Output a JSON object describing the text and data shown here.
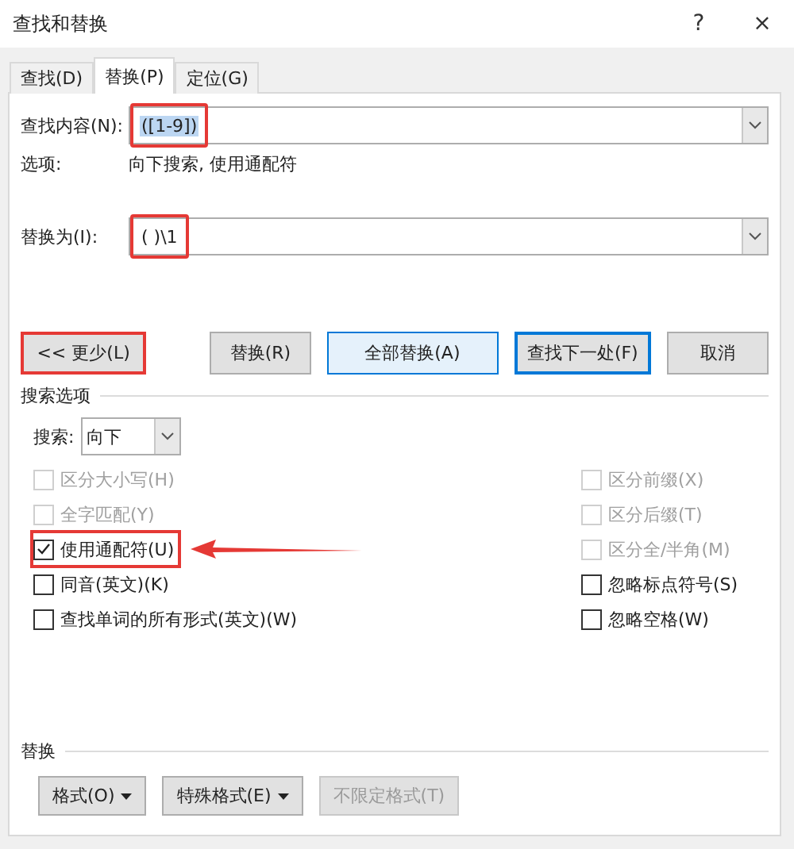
{
  "window": {
    "title": "查找和替换",
    "help": "?",
    "close": "×"
  },
  "tabs": [
    {
      "label": "查找(D)",
      "selected": false
    },
    {
      "label": "替换(P)",
      "selected": true
    },
    {
      "label": "定位(G)",
      "selected": false
    }
  ],
  "find": {
    "label": "查找内容(N):",
    "value": "([1-9])",
    "value_selected": true,
    "annotated": true
  },
  "options": {
    "label": "选项:",
    "value": "向下搜索, 使用通配符"
  },
  "replace": {
    "label": "替换为(I):",
    "value": "( )\\1",
    "annotated": true
  },
  "buttons": [
    {
      "label": "<< 更少(L)",
      "kind": "normal",
      "annotated": true
    },
    {
      "label": "替换(R)",
      "kind": "normal",
      "annotated": false
    },
    {
      "label": "全部替换(A)",
      "kind": "hover",
      "annotated": false
    },
    {
      "label": "查找下一处(F)",
      "kind": "default",
      "annotated": false
    },
    {
      "label": "取消",
      "kind": "normal",
      "annotated": false
    }
  ],
  "search_options": {
    "title": "搜索选项",
    "direction_label": "搜索:",
    "direction_value": "向下",
    "left": [
      {
        "label": "区分大小写(H)",
        "checked": false,
        "disabled": true,
        "annotated": false
      },
      {
        "label": "全字匹配(Y)",
        "checked": false,
        "disabled": true,
        "annotated": false
      },
      {
        "label": "使用通配符(U)",
        "checked": true,
        "disabled": false,
        "annotated": true
      },
      {
        "label": "同音(英文)(K)",
        "checked": false,
        "disabled": false,
        "annotated": false
      },
      {
        "label": "查找单词的所有形式(英文)(W)",
        "checked": false,
        "disabled": false,
        "annotated": false
      }
    ],
    "right": [
      {
        "label": "区分前缀(X)",
        "checked": false,
        "disabled": true
      },
      {
        "label": "区分后缀(T)",
        "checked": false,
        "disabled": true
      },
      {
        "label": "区分全/半角(M)",
        "checked": false,
        "disabled": true
      },
      {
        "label": "忽略标点符号(S)",
        "checked": false,
        "disabled": false
      },
      {
        "label": "忽略空格(W)",
        "checked": false,
        "disabled": false
      }
    ]
  },
  "replace_section": {
    "title": "替换",
    "buttons": [
      {
        "label": "格式(O)",
        "dropdown": true,
        "disabled": false
      },
      {
        "label": "特殊格式(E)",
        "dropdown": true,
        "disabled": false
      },
      {
        "label": "不限定格式(T)",
        "dropdown": false,
        "disabled": true
      }
    ]
  }
}
